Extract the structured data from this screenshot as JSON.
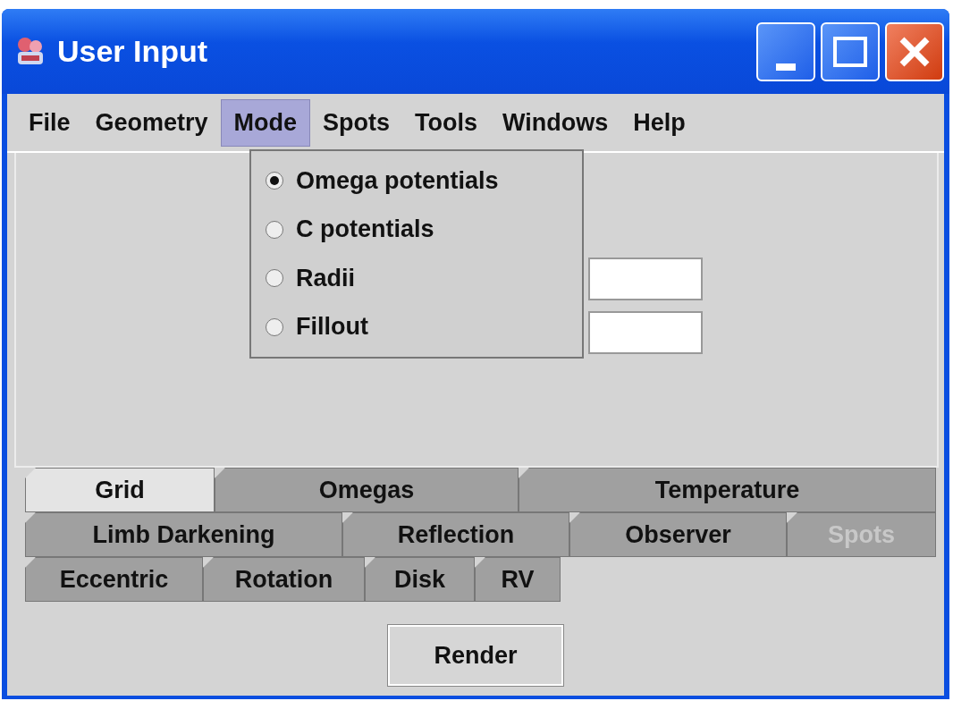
{
  "window": {
    "title": "User Input"
  },
  "menu_bar": [
    {
      "label": "File",
      "selected": false
    },
    {
      "label": "Geometry",
      "selected": false
    },
    {
      "label": "Mode",
      "selected": true
    },
    {
      "label": "Spots",
      "selected": false
    },
    {
      "label": "Tools",
      "selected": false
    },
    {
      "label": "Windows",
      "selected": false
    },
    {
      "label": "Help",
      "selected": false
    }
  ],
  "mode_menu": [
    {
      "label": "Omega potentials",
      "selected": true
    },
    {
      "label": "C potentials",
      "selected": false
    },
    {
      "label": "Radii",
      "selected": false
    },
    {
      "label": "Fillout",
      "selected": false
    }
  ],
  "tab_rows": [
    [
      {
        "label": "Grid",
        "selected": true,
        "disabled": false
      },
      {
        "label": "Omegas",
        "selected": false,
        "disabled": false
      },
      {
        "label": "Temperature",
        "selected": false,
        "disabled": false
      }
    ],
    [
      {
        "label": "Limb Darkening",
        "selected": false,
        "disabled": false
      },
      {
        "label": "Reflection",
        "selected": false,
        "disabled": false
      },
      {
        "label": "Observer",
        "selected": false,
        "disabled": false
      },
      {
        "label": "Spots",
        "selected": false,
        "disabled": true
      }
    ],
    [
      {
        "label": "Eccentric",
        "selected": false,
        "disabled": false
      },
      {
        "label": "Rotation",
        "selected": false,
        "disabled": false
      },
      {
        "label": "Disk",
        "selected": false,
        "disabled": false
      },
      {
        "label": "RV",
        "selected": false,
        "disabled": false
      }
    ]
  ],
  "render_button": "Render"
}
